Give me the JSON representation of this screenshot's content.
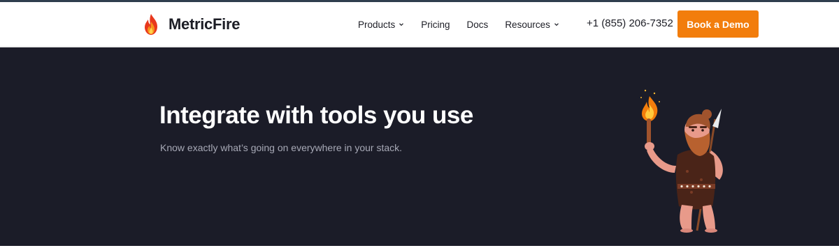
{
  "brand": {
    "name": "MetricFire",
    "icon": "flame-icon"
  },
  "nav": {
    "items": [
      {
        "label": "Products",
        "has_dropdown": true
      },
      {
        "label": "Pricing",
        "has_dropdown": false
      },
      {
        "label": "Docs",
        "has_dropdown": false
      },
      {
        "label": "Resources",
        "has_dropdown": true
      }
    ],
    "phone": "+1 (855) 206-7352",
    "cta_label": "Book a Demo"
  },
  "hero": {
    "title": "Integrate with tools you use",
    "subtitle": "Know exactly what’s going on everywhere in your stack.",
    "illustration": "caveman-with-torch-and-spear"
  },
  "colors": {
    "accent": "#f27d0c",
    "hero_background": "#1b1c28",
    "top_border": "#2f3e4e",
    "text_dark": "#1c1d25",
    "text_muted": "#a7a9b6"
  }
}
